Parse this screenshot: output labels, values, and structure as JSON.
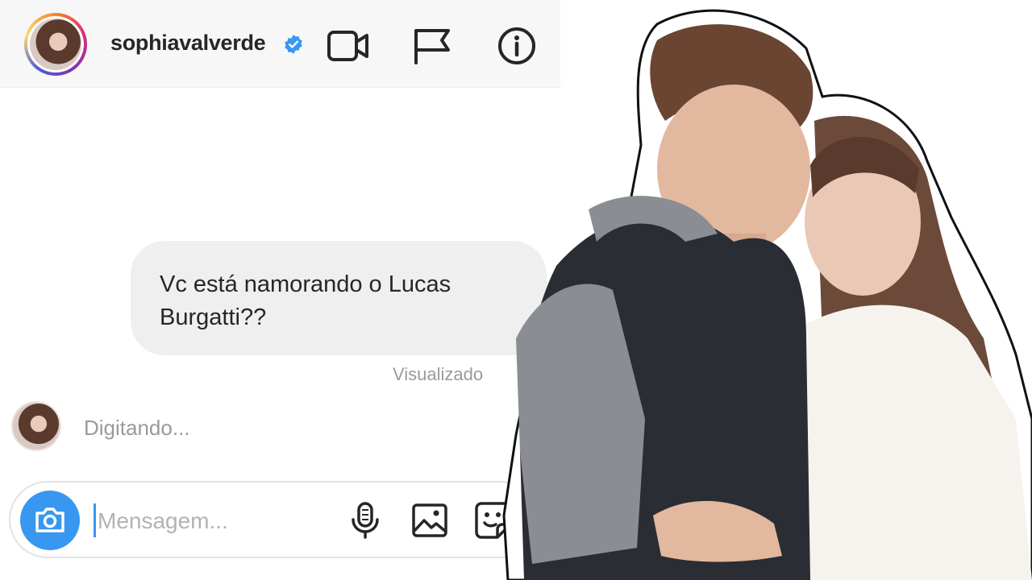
{
  "header": {
    "username": "sophiavalverde",
    "verified": true,
    "icons": [
      "video-call-icon",
      "flag-icon",
      "info-icon"
    ]
  },
  "thread": {
    "message": "Vc está namorando o Lucas Burgatti??",
    "seen_label": "Visualizado",
    "typing_label": "Digitando..."
  },
  "composer": {
    "placeholder": "Mensagem...",
    "icons": [
      "camera-icon",
      "microphone-icon",
      "gallery-icon",
      "sticker-icon"
    ]
  },
  "colors": {
    "accent": "#3897f0",
    "bubble": "#efefef",
    "header_bg": "#f7f7f7",
    "muted_text": "#9a9a9a"
  }
}
